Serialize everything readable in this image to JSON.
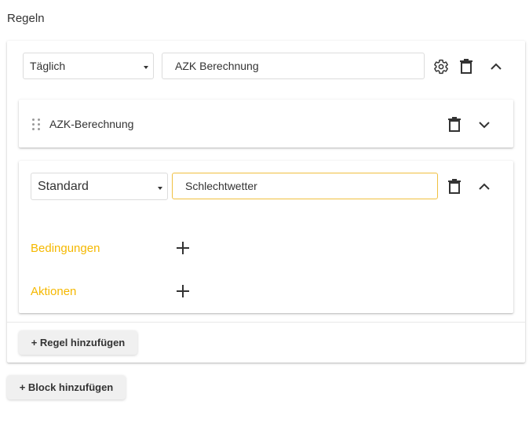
{
  "page": {
    "title": "Regeln"
  },
  "block": {
    "frequency_select": "Täglich",
    "name_input": "AZK Berechnung"
  },
  "rule1": {
    "name": "AZK-Berechnung"
  },
  "rule2": {
    "type_select": "Standard",
    "name_input": "Schlechtwetter",
    "conditions_label": "Bedingungen",
    "actions_label": "Aktionen"
  },
  "buttons": {
    "add_rule": "+ Regel hinzufügen",
    "add_block": "+ Block hinzufügen"
  },
  "colors": {
    "accent_yellow": "#f5b800",
    "focused_border": "#f0c040"
  },
  "icons": [
    "gear-icon",
    "trash-icon",
    "chevron-up-icon",
    "chevron-down-icon",
    "drag-handle-icon",
    "plus-icon"
  ]
}
